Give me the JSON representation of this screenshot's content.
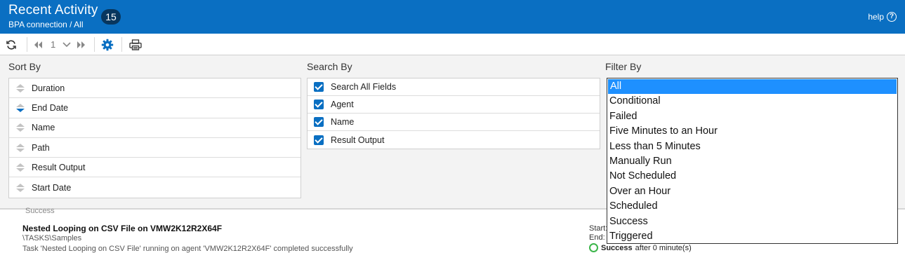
{
  "header": {
    "title": "Recent Activity",
    "subtitle": "BPA connection / All",
    "count": "15",
    "help_label": "help",
    "help_icon": "?"
  },
  "toolbar": {
    "page_number": "1"
  },
  "sort": {
    "title": "Sort By",
    "items": [
      {
        "label": "Duration",
        "active": false
      },
      {
        "label": "End Date",
        "active": true
      },
      {
        "label": "Name",
        "active": false
      },
      {
        "label": "Path",
        "active": false
      },
      {
        "label": "Result Output",
        "active": false
      },
      {
        "label": "Start Date",
        "active": false
      }
    ]
  },
  "search": {
    "title": "Search By",
    "items": [
      {
        "label": "Search All Fields",
        "checked": true
      },
      {
        "label": "Agent",
        "checked": true
      },
      {
        "label": "Name",
        "checked": true
      },
      {
        "label": "Result Output",
        "checked": true
      }
    ]
  },
  "filter": {
    "title": "Filter By",
    "options": [
      "All",
      "Conditional",
      "Failed",
      "Five Minutes to an Hour",
      "Less than 5 Minutes",
      "Manually Run",
      "Not Scheduled",
      "Over an Hour",
      "Scheduled",
      "Success",
      "Triggered"
    ],
    "selected": "All"
  },
  "task": {
    "prev_status": "Success",
    "title": "Nested Looping on CSV File on  VMW2K12R2X64F",
    "path": "\\TASKS\\Samples",
    "description": "Task 'Nested Looping on CSV File' running on agent 'VMW2K12R2X64F' completed successfully",
    "start_label": "Start:",
    "end_label": "End:",
    "status": "Success",
    "status_detail": "after 0 minute(s)"
  },
  "colors": {
    "header_bg": "#0a6fc2",
    "accent": "#0a6fc2",
    "selected_option": "#1e90ff",
    "success": "#3bb54a"
  }
}
